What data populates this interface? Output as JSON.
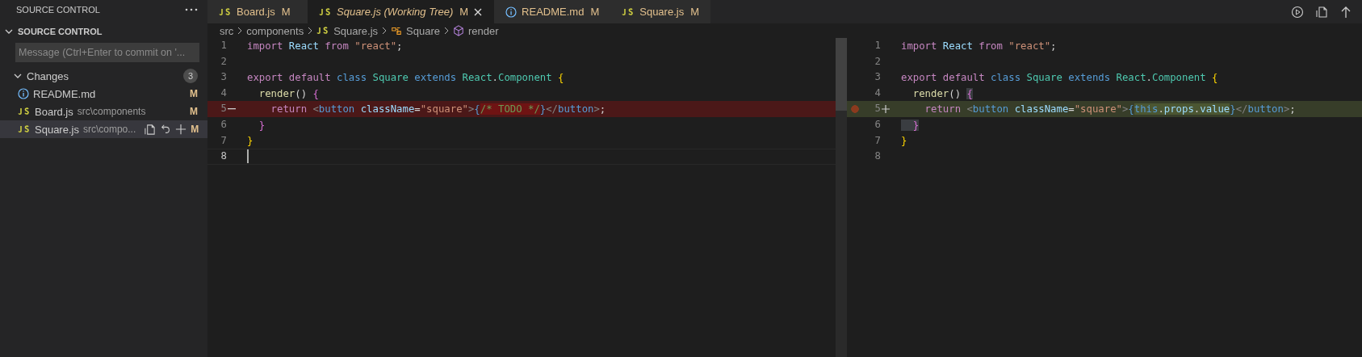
{
  "sidebar": {
    "title": "SOURCE CONTROL",
    "section_title": "SOURCE CONTROL",
    "message": {
      "placeholder": "Message (Ctrl+Enter to commit on '..."
    },
    "changes": {
      "label": "Changes",
      "count": "3",
      "expanded": true,
      "items": [
        {
          "name": "README.md",
          "kind": "readme",
          "status": "M",
          "selected": false
        },
        {
          "name": "Board.js",
          "path": "src\\components",
          "kind": "script",
          "status": "M",
          "selected": false
        },
        {
          "name": "Square.js",
          "path": "src\\compo...",
          "kind": "script",
          "status": "M",
          "selected": true
        }
      ]
    }
  },
  "tabs": [
    {
      "label": "Board.js",
      "kind": "script",
      "status": "M",
      "preview": false,
      "selected": false
    },
    {
      "label": "Square.js (Working Tree)",
      "kind": "script",
      "status": "M",
      "preview": true,
      "selected": true
    },
    {
      "label": "README.md",
      "kind": "readme",
      "status": "M",
      "preview": false,
      "selected": false
    },
    {
      "label": "Square.js",
      "kind": "script",
      "status": "M",
      "preview": false,
      "selected": false
    }
  ],
  "breadcrumb": [
    {
      "label": "src",
      "kind": "folder"
    },
    {
      "label": "components",
      "kind": "folder"
    },
    {
      "label": "Square.js",
      "kind": "script"
    },
    {
      "label": "Square",
      "kind": "class"
    },
    {
      "label": "render",
      "kind": "method"
    }
  ],
  "diff": {
    "left": [
      {
        "number": "1",
        "kind": "unchanged",
        "cursor": false,
        "breakpoint": false,
        "tokens": [
          {
            "text": "import ",
            "kind": "keyword"
          },
          {
            "text": "React ",
            "kind": "variable"
          },
          {
            "text": "from ",
            "kind": "keyword"
          },
          {
            "text": "\"react\"",
            "kind": "string"
          },
          {
            "text": ";",
            "kind": "plain"
          }
        ]
      },
      {
        "number": "2",
        "kind": "unchanged",
        "cursor": false,
        "breakpoint": false
      },
      {
        "number": "3",
        "kind": "unchanged",
        "cursor": false,
        "breakpoint": false,
        "tokens": [
          {
            "text": "export default ",
            "kind": "keyword"
          },
          {
            "text": "class ",
            "kind": "storage"
          },
          {
            "text": "Square ",
            "kind": "class"
          },
          {
            "text": "extends ",
            "kind": "storage"
          },
          {
            "text": "React",
            "kind": "class"
          },
          {
            "text": ".",
            "kind": "plain"
          },
          {
            "text": "Component ",
            "kind": "class"
          },
          {
            "text": "{",
            "kind": "brace"
          }
        ]
      },
      {
        "number": "4",
        "kind": "unchanged",
        "cursor": false,
        "breakpoint": false,
        "tokens": [
          {
            "text": "  render",
            "kind": "function"
          },
          {
            "text": "() ",
            "kind": "plain"
          },
          {
            "text": "{",
            "kind": "brace2"
          }
        ]
      },
      {
        "number": "5",
        "kind": "removed",
        "cursor": false,
        "breakpoint": false,
        "tokens": [
          {
            "text": "    return ",
            "kind": "keyword"
          },
          {
            "text": "<",
            "kind": "tag"
          },
          {
            "text": "button ",
            "kind": "storage"
          },
          {
            "text": "className",
            "kind": "variable"
          },
          {
            "text": "=",
            "kind": "plain"
          },
          {
            "text": "\"square\"",
            "kind": "string"
          },
          {
            "text": ">",
            "kind": "tag"
          },
          {
            "text": "{",
            "kind": "storage"
          },
          {
            "text": "/* TODO */",
            "kind": "comment",
            "highlight": true
          },
          {
            "text": "}",
            "kind": "storage"
          },
          {
            "text": "</",
            "kind": "tag"
          },
          {
            "text": "button",
            "kind": "storage"
          },
          {
            "text": ">",
            "kind": "tag"
          },
          {
            "text": ";",
            "kind": "plain"
          }
        ]
      },
      {
        "number": "6",
        "kind": "unchanged",
        "cursor": false,
        "breakpoint": false,
        "tokens": [
          {
            "text": "  }",
            "kind": "brace2"
          }
        ]
      },
      {
        "number": "7",
        "kind": "unchanged",
        "cursor": false,
        "breakpoint": false,
        "tokens": [
          {
            "text": "}",
            "kind": "brace"
          }
        ]
      },
      {
        "number": "8",
        "kind": "unchanged",
        "cursor": true,
        "breakpoint": false
      }
    ],
    "right": [
      {
        "number": "1",
        "kind": "unchanged",
        "cursor": false,
        "breakpoint": false,
        "tokens": [
          {
            "text": "import ",
            "kind": "keyword"
          },
          {
            "text": "React ",
            "kind": "variable"
          },
          {
            "text": "from ",
            "kind": "keyword"
          },
          {
            "text": "\"react\"",
            "kind": "string"
          },
          {
            "text": ";",
            "kind": "plain"
          }
        ]
      },
      {
        "number": "2",
        "kind": "unchanged",
        "cursor": false,
        "breakpoint": false
      },
      {
        "number": "3",
        "kind": "unchanged",
        "cursor": false,
        "breakpoint": false,
        "tokens": [
          {
            "text": "export default ",
            "kind": "keyword"
          },
          {
            "text": "class ",
            "kind": "storage"
          },
          {
            "text": "Square ",
            "kind": "class"
          },
          {
            "text": "extends ",
            "kind": "storage"
          },
          {
            "text": "React",
            "kind": "class"
          },
          {
            "text": ".",
            "kind": "plain"
          },
          {
            "text": "Component ",
            "kind": "class"
          },
          {
            "text": "{",
            "kind": "brace"
          }
        ]
      },
      {
        "number": "4",
        "kind": "unchanged",
        "cursor": false,
        "breakpoint": false,
        "tokens": [
          {
            "text": "  render",
            "kind": "function"
          },
          {
            "text": "() ",
            "kind": "plain"
          },
          {
            "text": "{",
            "kind": "brace2",
            "highlight": true
          }
        ]
      },
      {
        "number": "5",
        "kind": "added",
        "cursor": false,
        "breakpoint": true,
        "tokens": [
          {
            "text": "    return ",
            "kind": "keyword"
          },
          {
            "text": "<",
            "kind": "tag"
          },
          {
            "text": "button ",
            "kind": "storage"
          },
          {
            "text": "className",
            "kind": "variable"
          },
          {
            "text": "=",
            "kind": "plain"
          },
          {
            "text": "\"square\"",
            "kind": "string"
          },
          {
            "text": ">",
            "kind": "tag"
          },
          {
            "text": "{",
            "kind": "storage"
          },
          {
            "text": "this",
            "kind": "storage",
            "highlight": true
          },
          {
            "text": ".",
            "kind": "plain",
            "highlight": true
          },
          {
            "text": "props",
            "kind": "variable",
            "highlight": true
          },
          {
            "text": ".",
            "kind": "plain",
            "highlight": true
          },
          {
            "text": "value",
            "kind": "variable",
            "highlight": true
          },
          {
            "text": "}",
            "kind": "storage"
          },
          {
            "text": "</",
            "kind": "tag"
          },
          {
            "text": "button",
            "kind": "storage"
          },
          {
            "text": ">",
            "kind": "tag"
          },
          {
            "text": ";",
            "kind": "plain"
          }
        ]
      },
      {
        "number": "6",
        "kind": "unchanged",
        "cursor": false,
        "breakpoint": false,
        "tokens": [
          {
            "text": "  }",
            "kind": "brace2",
            "highlight": true
          }
        ]
      },
      {
        "number": "7",
        "kind": "unchanged",
        "cursor": false,
        "breakpoint": false,
        "tokens": [
          {
            "text": "}",
            "kind": "brace"
          }
        ]
      },
      {
        "number": "8",
        "kind": "unchanged",
        "cursor": false,
        "breakpoint": false
      }
    ]
  }
}
